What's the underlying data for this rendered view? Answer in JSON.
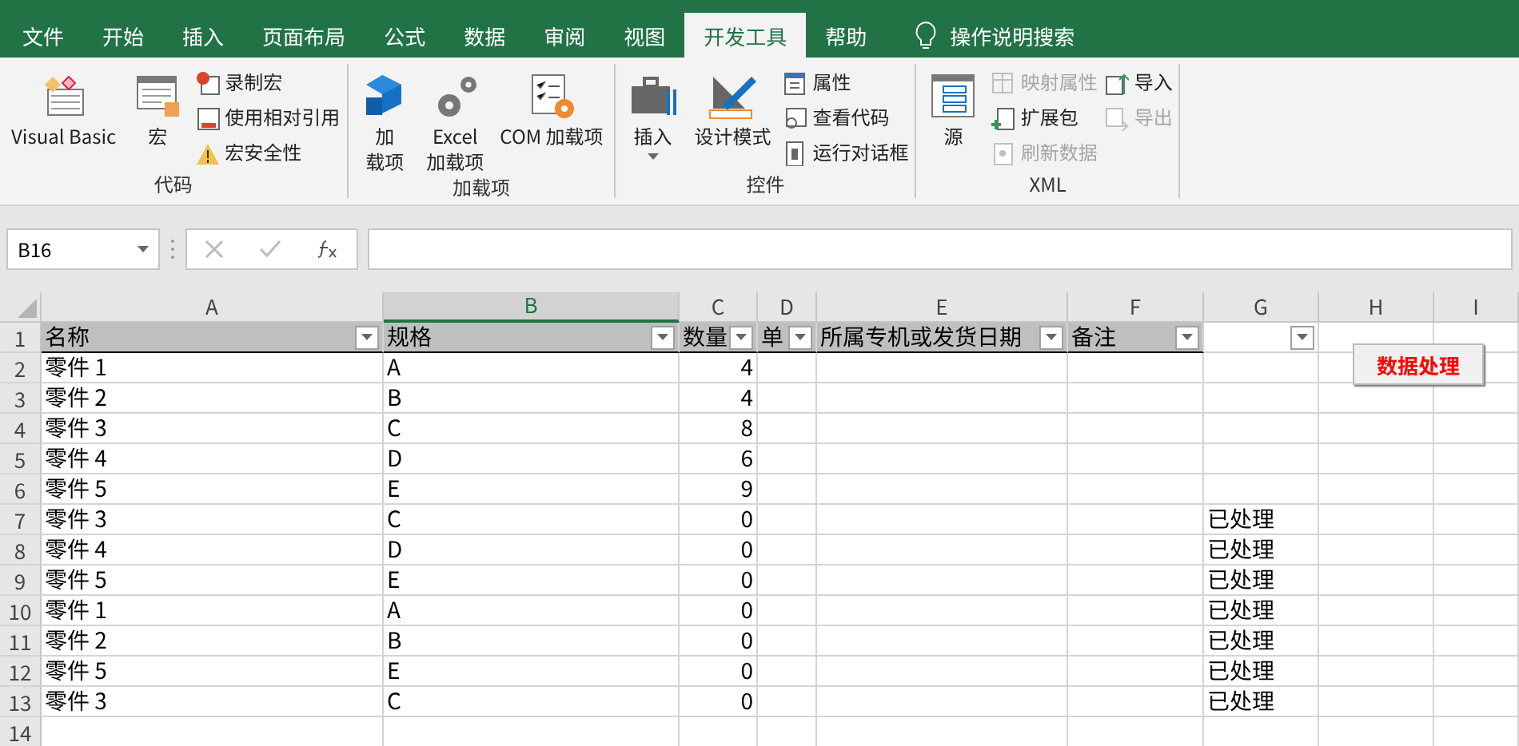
{
  "tabs": [
    {
      "label": "文件",
      "selected": false
    },
    {
      "label": "开始",
      "selected": false
    },
    {
      "label": "插入",
      "selected": false
    },
    {
      "label": "页面布局",
      "selected": false
    },
    {
      "label": "公式",
      "selected": false
    },
    {
      "label": "数据",
      "selected": false
    },
    {
      "label": "审阅",
      "selected": false
    },
    {
      "label": "视图",
      "selected": false
    },
    {
      "label": "开发工具",
      "selected": true
    },
    {
      "label": "帮助",
      "selected": false
    }
  ],
  "tell_me": "操作说明搜索",
  "ribbon_groups": [
    {
      "title": "代码",
      "columns": [
        {
          "kind": "large",
          "lines": [
            "Visual Basic"
          ]
        },
        {
          "kind": "large",
          "lines": [
            "宏"
          ]
        },
        {
          "kind": "stack",
          "items": [
            {
              "label": "录制宏",
              "disabled": false
            },
            {
              "label": "使用相对引用",
              "disabled": false
            },
            {
              "label": "宏安全性",
              "disabled": false
            }
          ]
        }
      ]
    },
    {
      "title": "加载项",
      "columns": [
        {
          "kind": "large",
          "lines": [
            "加",
            "载项"
          ]
        },
        {
          "kind": "large",
          "lines": [
            "Excel",
            "加载项"
          ]
        },
        {
          "kind": "large",
          "lines": [
            "COM 加载项"
          ]
        }
      ]
    },
    {
      "title": "控件",
      "columns": [
        {
          "kind": "large",
          "lines": [
            "插入"
          ],
          "dropdown": true
        },
        {
          "kind": "large",
          "lines": [
            "设计模式"
          ]
        },
        {
          "kind": "stack",
          "items": [
            {
              "label": "属性",
              "disabled": false
            },
            {
              "label": "查看代码",
              "disabled": false
            },
            {
              "label": "运行对话框",
              "disabled": false
            }
          ]
        }
      ]
    },
    {
      "title": "XML",
      "columns": [
        {
          "kind": "large",
          "lines": [
            "源"
          ]
        },
        {
          "kind": "stack",
          "items": [
            {
              "label": "映射属性",
              "disabled": true
            },
            {
              "label": "扩展包",
              "disabled": false
            },
            {
              "label": "刷新数据",
              "disabled": true
            }
          ]
        },
        {
          "kind": "stack",
          "items": [
            {
              "label": "导入",
              "disabled": false
            },
            {
              "label": "导出",
              "disabled": true
            }
          ]
        }
      ]
    }
  ],
  "name_box": "B16",
  "column_headers": [
    {
      "label": "A",
      "selected": false
    },
    {
      "label": "B",
      "selected": true
    },
    {
      "label": "C",
      "selected": false
    },
    {
      "label": "D",
      "selected": false
    },
    {
      "label": "E",
      "selected": false
    },
    {
      "label": "F",
      "selected": false
    },
    {
      "label": "G",
      "selected": false
    },
    {
      "label": "H",
      "selected": false
    },
    {
      "label": "I",
      "selected": false
    }
  ],
  "header_row_number": "1",
  "header_row": [
    {
      "label": "名称",
      "filter": true
    },
    {
      "label": "规格",
      "filter": true
    },
    {
      "label": "数量",
      "filter": true
    },
    {
      "label": "单",
      "filter": true
    },
    {
      "label": "所属专机或发货日期",
      "filter": true
    },
    {
      "label": "备注",
      "filter": true
    },
    {
      "filter": true
    },
    {
      "filter": false
    },
    {
      "filter": false
    }
  ],
  "rows": [
    {
      "row_number": "2",
      "name": "零件 1",
      "spec": "A",
      "qty": "4"
    },
    {
      "row_number": "3",
      "name": "零件 2",
      "spec": "B",
      "qty": "4"
    },
    {
      "row_number": "4",
      "name": "零件 3",
      "spec": "C",
      "qty": "8"
    },
    {
      "row_number": "5",
      "name": "零件 4",
      "spec": "D",
      "qty": "6"
    },
    {
      "row_number": "6",
      "name": "零件 5",
      "spec": "E",
      "qty": "9"
    },
    {
      "row_number": "7",
      "name": "零件 3",
      "spec": "C",
      "qty": "0",
      "status": "已处理"
    },
    {
      "row_number": "8",
      "name": "零件 4",
      "spec": "D",
      "qty": "0",
      "status": "已处理"
    },
    {
      "row_number": "9",
      "name": "零件 5",
      "spec": "E",
      "qty": "0",
      "status": "已处理"
    },
    {
      "row_number": "10",
      "name": "零件 1",
      "spec": "A",
      "qty": "0",
      "status": "已处理"
    },
    {
      "row_number": "11",
      "name": "零件 2",
      "spec": "B",
      "qty": "0",
      "status": "已处理"
    },
    {
      "row_number": "12",
      "name": "零件 5",
      "spec": "E",
      "qty": "0",
      "status": "已处理"
    },
    {
      "row_number": "13",
      "name": "零件 3",
      "spec": "C",
      "qty": "0",
      "status": "已处理"
    },
    {
      "row_number": "14"
    }
  ],
  "sheet_button": "数据处理"
}
